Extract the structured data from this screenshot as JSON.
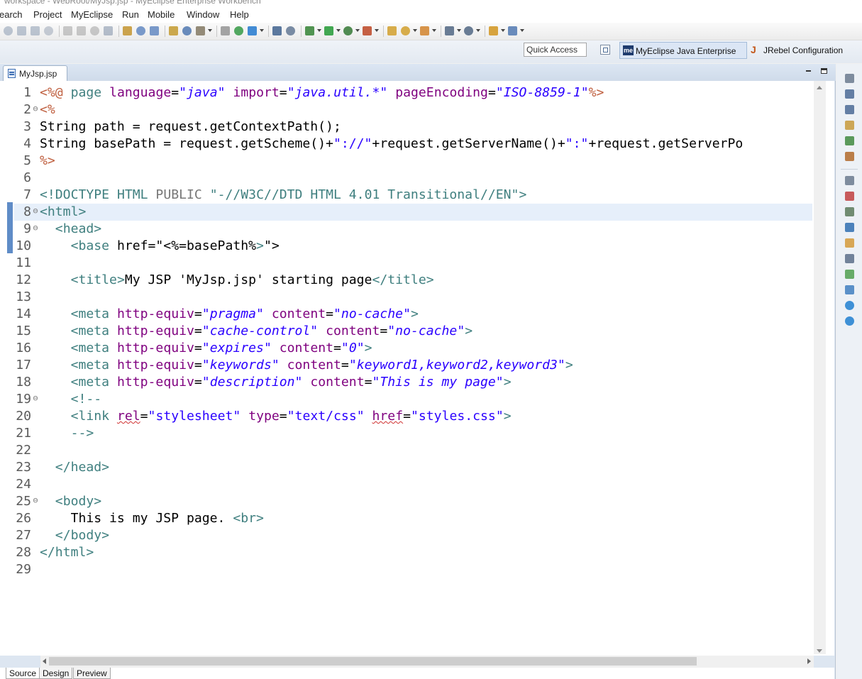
{
  "window": {
    "title": "workspace - WebRoot/MyJsp.jsp - MyEclipse Enterprise Workbench"
  },
  "menu": [
    "Search",
    "Project",
    "MyEclipse",
    "Run",
    "Mobile",
    "Window",
    "Help"
  ],
  "menu_visible": [
    "earch",
    "Project",
    "MyEclipse",
    "Run",
    "Mobile",
    "Window",
    "Help"
  ],
  "quick_access": {
    "placeholder": "Quick Access"
  },
  "perspectives": [
    {
      "label": "MyEclipse Java Enterprise",
      "active": true
    },
    {
      "label": "JRebel Configuration",
      "active": false
    }
  ],
  "editor": {
    "tab_label": "MyJsp.jsp",
    "current_line": 8,
    "bottom_tabs": [
      "Source",
      "Design",
      "Preview"
    ],
    "active_bottom_tab": "Source"
  },
  "code_lines": [
    {
      "n": "1",
      "fold": "",
      "text": "<%@ page language=\"java\" import=\"java.util.*\" pageEncoding=\"ISO-8859-1\"%>"
    },
    {
      "n": "2",
      "fold": "⊖",
      "text": "<%"
    },
    {
      "n": "3",
      "fold": "",
      "text": "String path = request.getContextPath();"
    },
    {
      "n": "4",
      "fold": "",
      "text": "String basePath = request.getScheme()+\"://\"+request.getServerName()+\":\"+request.getServerPo"
    },
    {
      "n": "5",
      "fold": "",
      "text": "%>"
    },
    {
      "n": "6",
      "fold": "",
      "text": ""
    },
    {
      "n": "7",
      "fold": "",
      "text": "<!DOCTYPE HTML PUBLIC \"-//W3C//DTD HTML 4.01 Transitional//EN\">"
    },
    {
      "n": "8",
      "fold": "⊖",
      "text": "<html>"
    },
    {
      "n": "9",
      "fold": "⊖",
      "text": "  <head>"
    },
    {
      "n": "10",
      "fold": "",
      "text": "    <base href=\"<%=basePath%>\">"
    },
    {
      "n": "11",
      "fold": "",
      "text": ""
    },
    {
      "n": "12",
      "fold": "",
      "text": "    <title>My JSP 'MyJsp.jsp' starting page</title>"
    },
    {
      "n": "13",
      "fold": "",
      "text": ""
    },
    {
      "n": "14",
      "fold": "",
      "text": "    <meta http-equiv=\"pragma\" content=\"no-cache\">"
    },
    {
      "n": "15",
      "fold": "",
      "text": "    <meta http-equiv=\"cache-control\" content=\"no-cache\">"
    },
    {
      "n": "16",
      "fold": "",
      "text": "    <meta http-equiv=\"expires\" content=\"0\">"
    },
    {
      "n": "17",
      "fold": "",
      "text": "    <meta http-equiv=\"keywords\" content=\"keyword1,keyword2,keyword3\">"
    },
    {
      "n": "18",
      "fold": "",
      "text": "    <meta http-equiv=\"description\" content=\"This is my page\">"
    },
    {
      "n": "19",
      "fold": "⊖",
      "text": "    <!--"
    },
    {
      "n": "20",
      "fold": "",
      "text": "    <link rel=\"stylesheet\" type=\"text/css\" href=\"styles.css\">"
    },
    {
      "n": "21",
      "fold": "",
      "text": "    -->"
    },
    {
      "n": "22",
      "fold": "",
      "text": ""
    },
    {
      "n": "23",
      "fold": "",
      "text": "  </head>"
    },
    {
      "n": "24",
      "fold": "",
      "text": ""
    },
    {
      "n": "25",
      "fold": "⊖",
      "text": "  <body>"
    },
    {
      "n": "26",
      "fold": "",
      "text": "    This is my JSP page. <br>"
    },
    {
      "n": "27",
      "fold": "",
      "text": "  </body>"
    },
    {
      "n": "28",
      "fold": "",
      "text": "</html>"
    },
    {
      "n": "29",
      "fold": "",
      "text": ""
    }
  ],
  "toolbar_icons": [
    "run-last-icon",
    "suspend-icon",
    "terminate-icon",
    "disconnect-icon",
    "step-into-icon",
    "step-over-icon",
    "step-return-icon",
    "build-icon",
    "new-icon",
    "undo-icon",
    "redo-icon",
    "deploy-icon",
    "server-icon",
    "settings-icon",
    "new-jsp-icon",
    "html-icon",
    "grid-icon",
    "table-icon",
    "open-type-icon",
    "debug-icon",
    "run-icon",
    "profile-icon",
    "external-tools-icon",
    "open-folder-icon",
    "open-project-icon",
    "search-icon",
    "next-annotation-icon",
    "prev-annotation-icon",
    "back-icon",
    "forward-icon"
  ],
  "right_trim_icons": [
    "restore-icon",
    "outline-icon",
    "hierarchy-icon",
    "tasks-icon",
    "debug-icon",
    "junit-icon",
    "restore-icon",
    "bookmarks-icon",
    "servers-icon",
    "console-icon",
    "plugin-icon",
    "properties-icon",
    "snippets-icon",
    "web-browser-icon",
    "image-preview-icon",
    "jrebel-icon"
  ],
  "colors": {
    "keyword": "#7f0055",
    "tag": "#3f7f7f",
    "attribute": "#7f007f",
    "string": "#2a00ff",
    "jsp_delim": "#bf5f3f",
    "comment": "#3f5fbf",
    "current_line_bg": "#e6effa",
    "frame": "#dde6f1"
  }
}
